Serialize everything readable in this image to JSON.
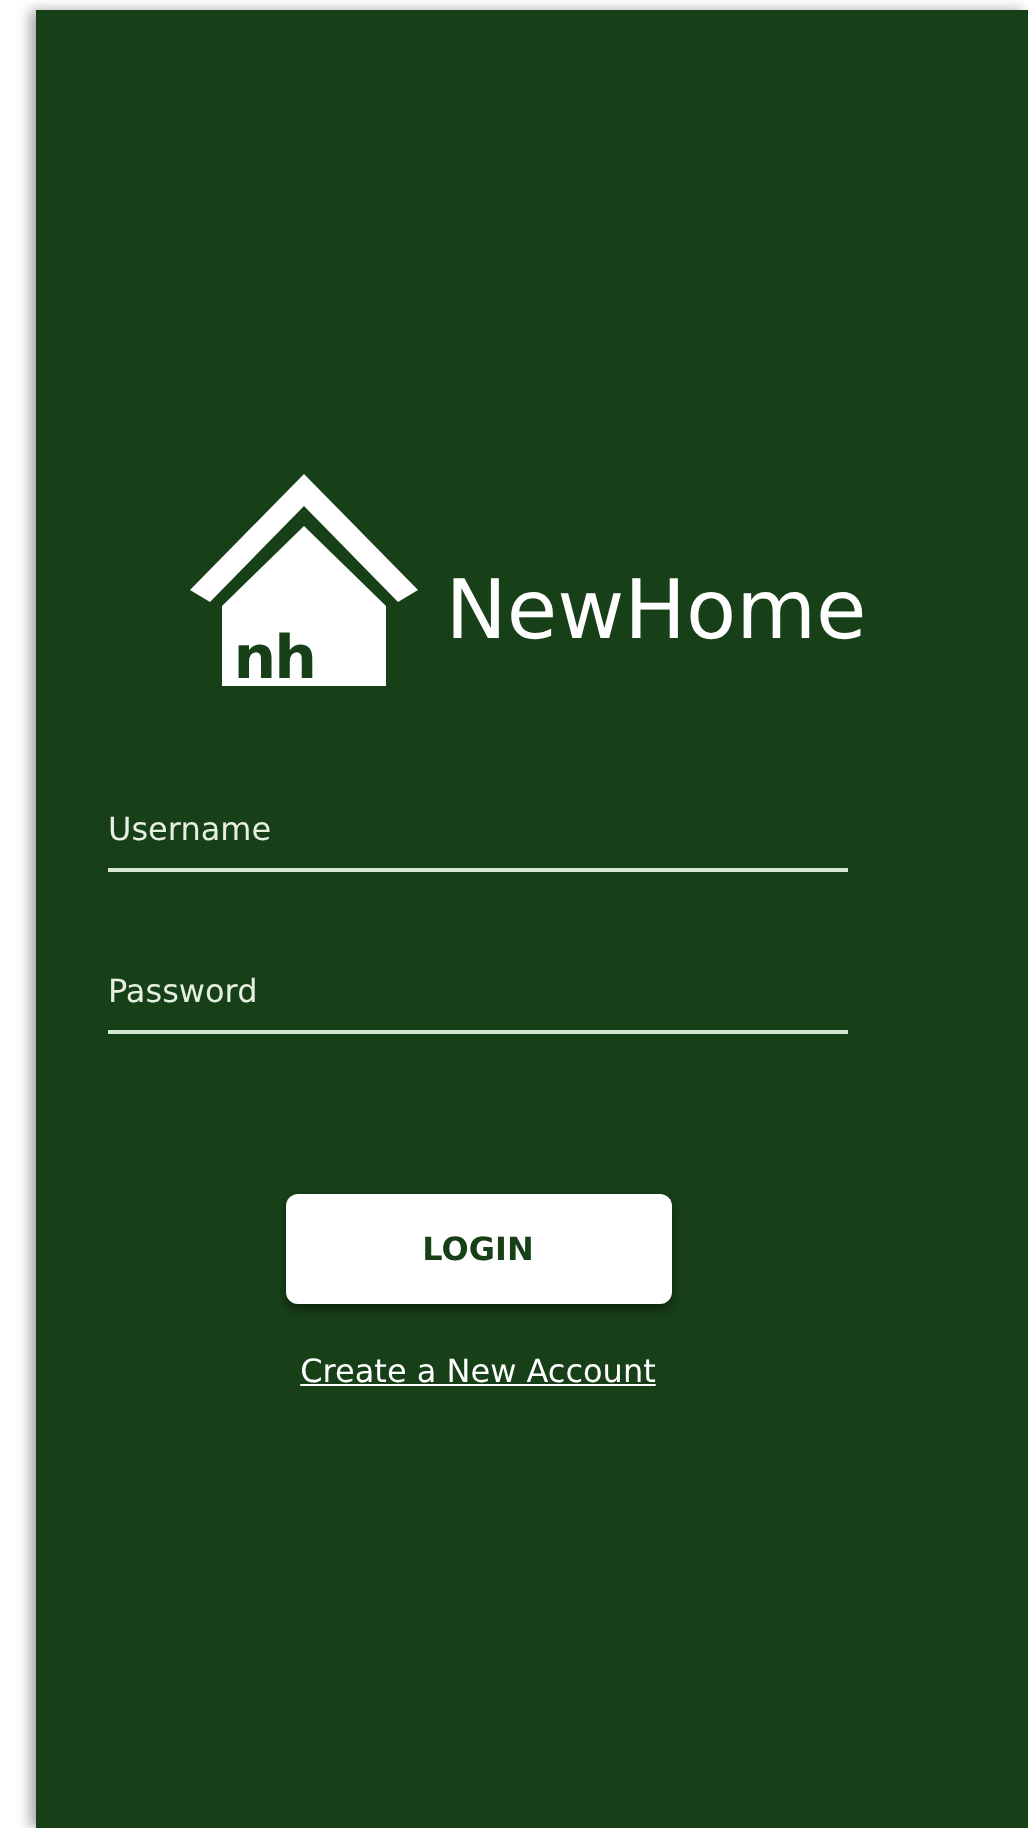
{
  "logo": {
    "mark": "nh",
    "name": "NewHome"
  },
  "fields": [
    {
      "placeholder": "Username"
    },
    {
      "placeholder": "Password"
    }
  ],
  "login_button": "LOGIN",
  "create_account_link": "Create a New Account"
}
